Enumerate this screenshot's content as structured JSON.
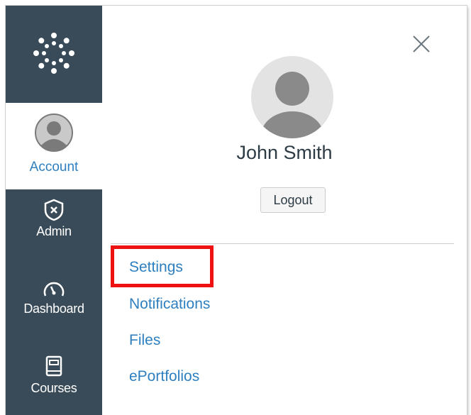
{
  "nav": {
    "logo_icon": "canvas-logo-icon",
    "account_label": "Account",
    "items": [
      {
        "label": "Admin",
        "icon": "shield-icon"
      },
      {
        "label": "Dashboard",
        "icon": "speedometer-icon"
      },
      {
        "label": "Courses",
        "icon": "book-icon"
      }
    ]
  },
  "tray": {
    "user_name": "John Smith",
    "logout_label": "Logout",
    "links": [
      {
        "label": "Settings",
        "highlighted": true
      },
      {
        "label": "Notifications"
      },
      {
        "label": "Files"
      },
      {
        "label": "ePortfolios"
      }
    ],
    "close_icon": "close-icon"
  },
  "colors": {
    "nav_bg": "#394b58",
    "link": "#2d7fbf",
    "highlight": "#ee1111",
    "text": "#2d3b45"
  }
}
